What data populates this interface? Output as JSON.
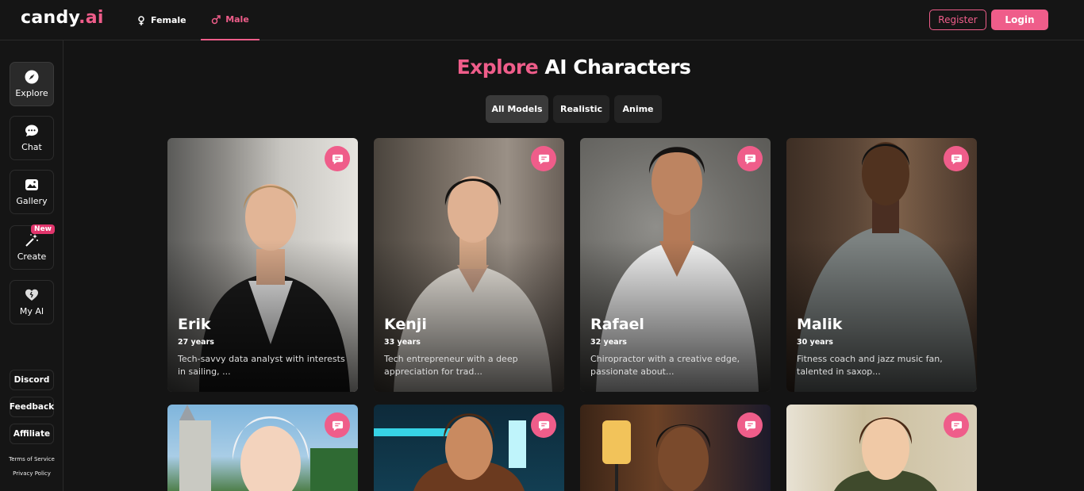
{
  "header": {
    "logo_main": "candy",
    "logo_dot": ".ai",
    "tabs": [
      {
        "label": "Female",
        "icon": "female-symbol-icon"
      },
      {
        "label": "Male",
        "icon": "male-symbol-icon",
        "active": true
      }
    ],
    "register_label": "Register",
    "login_label": "Login"
  },
  "sidebar": {
    "items": [
      {
        "label": "Explore",
        "icon": "compass-icon",
        "active": true
      },
      {
        "label": "Chat",
        "icon": "chat-bubble-icon"
      },
      {
        "label": "Gallery",
        "icon": "gallery-icon"
      },
      {
        "label": "Create",
        "icon": "magic-wand-icon",
        "badge": "New"
      },
      {
        "label": "My AI",
        "icon": "heart-icon"
      }
    ],
    "bottom": [
      {
        "label": "Discord"
      },
      {
        "label": "Feedback"
      },
      {
        "label": "Affiliate"
      }
    ],
    "links": [
      "Terms of Service",
      "Privacy Policy"
    ]
  },
  "main": {
    "title_accent": "Explore",
    "title_rest": "AI Characters",
    "filters": [
      {
        "label": "All Models",
        "active": true
      },
      {
        "label": "Realistic"
      },
      {
        "label": "Anime"
      }
    ],
    "characters": [
      {
        "name": "Erik",
        "age": "27 years",
        "description": "Tech-savvy data analyst with interests in sailing, ..."
      },
      {
        "name": "Kenji",
        "age": "33 years",
        "description": "Tech entrepreneur with a deep appreciation for trad..."
      },
      {
        "name": "Rafael",
        "age": "32 years",
        "description": "Chiropractor with a creative edge, passionate about..."
      },
      {
        "name": "Malik",
        "age": "30 years",
        "description": "Fitness coach and jazz music fan, talented in saxop..."
      }
    ]
  },
  "colors": {
    "accent": "#ef5d8a",
    "background": "#141414",
    "surface": "#232323"
  }
}
